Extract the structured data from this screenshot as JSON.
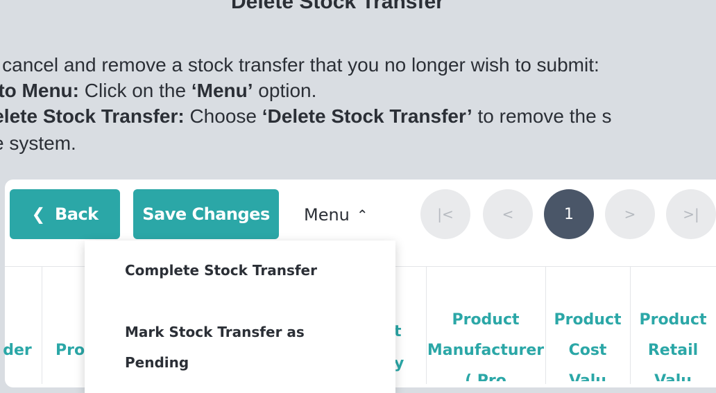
{
  "doc": {
    "title": "Delete Stock Transfer",
    "intro": "to cancel and remove a stock transfer that you no longer wish to submit:",
    "step1_bold": "e to Menu:",
    "step1_text": " Click on the ",
    "step1_quote": "‘Menu’",
    "step1_end": " option.",
    "step2_bold": "Delete Stock Transfer:",
    "step2_text": " Choose ",
    "step2_quote": "‘Delete Stock Transfer’",
    "step2_end": " to remove the s",
    "step3": "e system."
  },
  "toolbar": {
    "back_label": "Back",
    "save_label": "Save Changes",
    "menu_label": "Menu"
  },
  "pagination": {
    "first": "|<",
    "prev": "<",
    "current": "1",
    "next": ">",
    "last": ">|"
  },
  "table": {
    "headers": {
      "order": "der",
      "pro": "Pro",
      "manufacturer": "Product Manufacturer",
      "manufacturer_cut": "( Pro",
      "cost": "Product Cost",
      "cost_cut": "Valu",
      "retail": "Product Retail",
      "retail_cut": "Valu",
      "cat_a": "t",
      "cat_b": "y"
    }
  },
  "menu": {
    "items": [
      "Complete Stock Transfer",
      "Mark Stock Transfer as Pending"
    ]
  },
  "colors": {
    "accent": "#2ba7a7",
    "pager_active": "#4a5668",
    "background": "#d9dde2"
  }
}
